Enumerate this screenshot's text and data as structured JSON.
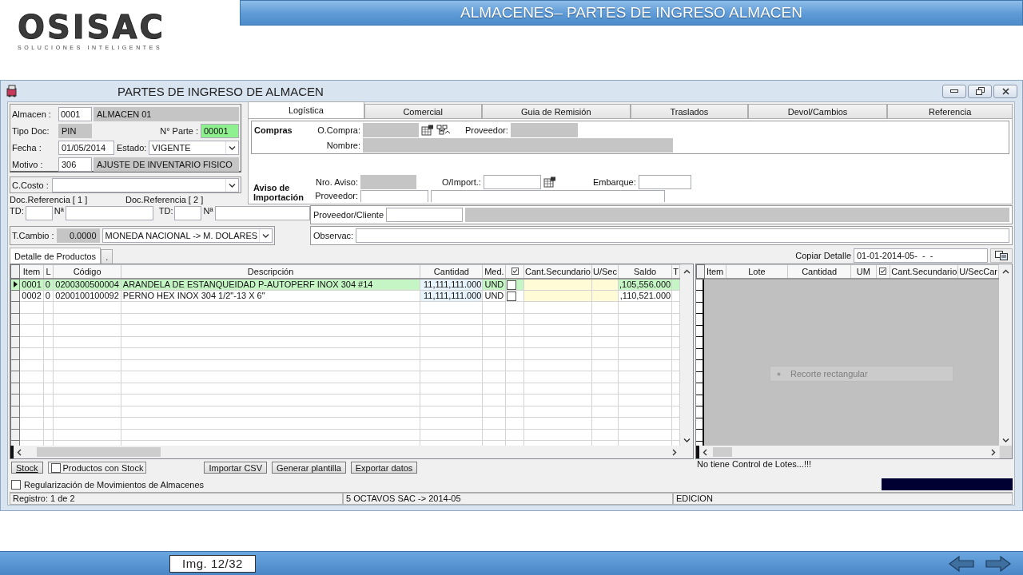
{
  "slide": {
    "logo": {
      "name": "OSISAC",
      "tagline": "SOLUCIONES INTELIGENTES"
    },
    "title": "ALMACENES– PARTES DE INGRESO ALMACEN",
    "image_counter": "Img. 12/32"
  },
  "window": {
    "title": "PARTES DE INGRESO DE ALMACEN"
  },
  "document": {
    "almacen": {
      "label": "Almacen :",
      "code": "0001",
      "name": "ALMACEN 01"
    },
    "tipo_doc": {
      "label": "Tipo Doc:",
      "value": "PIN"
    },
    "n_parte": {
      "label": "N° Parte :",
      "value": "00001"
    },
    "fecha": {
      "label": "Fecha :",
      "value": "01/05/2014"
    },
    "estado": {
      "label": "Estado:",
      "value": "VIGENTE"
    },
    "motivo": {
      "label": "Motivo :",
      "code": "306",
      "name": "AJUSTE DE INVENTARIO FISICO"
    },
    "c_costo": {
      "label": "C.Costo :"
    },
    "doc_refs": [
      {
        "title": "Doc.Referencia [ 1 ]",
        "td_label": "TD:",
        "number_label": "Nª"
      },
      {
        "title": "Doc.Referencia [ 2 ]",
        "td_label": "TD:",
        "number_label": "Nª"
      }
    ],
    "t_cambio": {
      "label": "T.Cambio :",
      "value": "0.0000",
      "currency": "MONEDA NACIONAL -> M. DOLARES"
    }
  },
  "tabs": [
    {
      "label": "Logística",
      "selected": true
    },
    {
      "label": "Comercial",
      "selected": false
    },
    {
      "label": "Guia de Remisión",
      "selected": false
    },
    {
      "label": "Traslados",
      "selected": false
    },
    {
      "label": "Devol/Cambios",
      "selected": false
    },
    {
      "label": "Referencia",
      "selected": false
    }
  ],
  "logistica": {
    "compras": {
      "title": "Compras",
      "orden_label": "O.Compra:",
      "proveedor_label": "Proveedor:",
      "nombre_label": "Nombre:"
    },
    "aviso": {
      "title": "Aviso de Importación",
      "nro_label": "Nro. Aviso:",
      "import_label": "O/Import.:",
      "embarque_label": "Embarque:",
      "proveedor_label": "Proveedor:"
    }
  },
  "proveedor_cliente": {
    "label": "Proveedor/Cliente"
  },
  "observac": {
    "label": "Observac:"
  },
  "detail_tabs": [
    {
      "label": "Detalle de Productos",
      "selected": true
    },
    {
      "label": ".",
      "selected": false
    }
  ],
  "copiar_detalle": {
    "label": "Copiar Detalle",
    "value": "01-01-2014-05-  -  -"
  },
  "products": {
    "columns": [
      {
        "kind": "text",
        "label": "Item"
      },
      {
        "kind": "text",
        "label": "L"
      },
      {
        "kind": "text",
        "label": "Código"
      },
      {
        "kind": "text",
        "label": "Descripción"
      },
      {
        "kind": "number",
        "label": "Cantidad"
      },
      {
        "kind": "text",
        "label": "Med."
      },
      {
        "kind": "check"
      },
      {
        "kind": "entry",
        "label": "Cant.Secundario"
      },
      {
        "kind": "entry",
        "label": "U/Sec"
      },
      {
        "kind": "number",
        "label": "Saldo"
      },
      {
        "kind": "text",
        "label": "T"
      }
    ],
    "rows": [
      {
        "item": "0001",
        "l": "0",
        "codigo": "0200300500004",
        "descripcion": "ARANDELA DE ESTANQUEIDAD P-AUTOPERF INOX 304 #14",
        "cantidad": "11,111,111.000",
        "med": "UND",
        "checked": false,
        "saldo": ",105,556.000",
        "selected": true
      },
      {
        "item": "0002",
        "l": "0",
        "codigo": "0200100100092",
        "descripcion": "PERNO HEX INOX 304 1/2\"-13 X 6\"",
        "cantidad": "11,111,111.000",
        "med": "UND",
        "checked": false,
        "saldo": ",110,521.000",
        "selected": false
      }
    ]
  },
  "lots": {
    "columns": [
      {
        "kind": "text",
        "label": "Item"
      },
      {
        "kind": "text",
        "label": "Lote"
      },
      {
        "kind": "number",
        "label": "Cantidad"
      },
      {
        "kind": "text",
        "label": "UM"
      },
      {
        "kind": "check"
      },
      {
        "kind": "text",
        "label": "Cant.Secundario"
      },
      {
        "kind": "text",
        "label": "U/SecCar"
      }
    ],
    "message": "No tiene Control de Lotes...!!!"
  },
  "overlay_hint": "Recorte rectangular",
  "actions": [
    {
      "kind": "button",
      "label": "Stock"
    },
    {
      "kind": "checkbox",
      "label": "Productos con Stock",
      "checked": false
    },
    {
      "kind": "button",
      "label": "Importar CSV"
    },
    {
      "kind": "button",
      "label": "Generar plantilla"
    },
    {
      "kind": "button",
      "label": "Exportar datos"
    }
  ],
  "regularizacion": {
    "label": "Regularización de Movimientos de Almacenes",
    "checked": false
  },
  "status_bar": [
    "Registro: 1 de 2",
    "5 OCTAVOS SAC -> 2014-05",
    "EDICION"
  ]
}
